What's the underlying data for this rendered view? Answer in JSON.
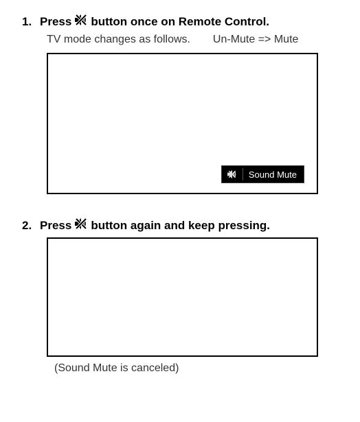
{
  "step1": {
    "num": "1.",
    "pre": "Press",
    "post": "button once on Remote Control.",
    "sub_a": "TV mode changes as follows.",
    "sub_b": "Un-Mute => Mute",
    "osd_label": "Sound Mute"
  },
  "step2": {
    "num": "2.",
    "pre": "Press",
    "post": "button again and keep pressing.",
    "cancel_note": "(Sound Mute is canceled)"
  },
  "icons": {
    "mute_button": "mute-crossed-icon",
    "osd_mute": "mute-crossed-icon-small"
  }
}
